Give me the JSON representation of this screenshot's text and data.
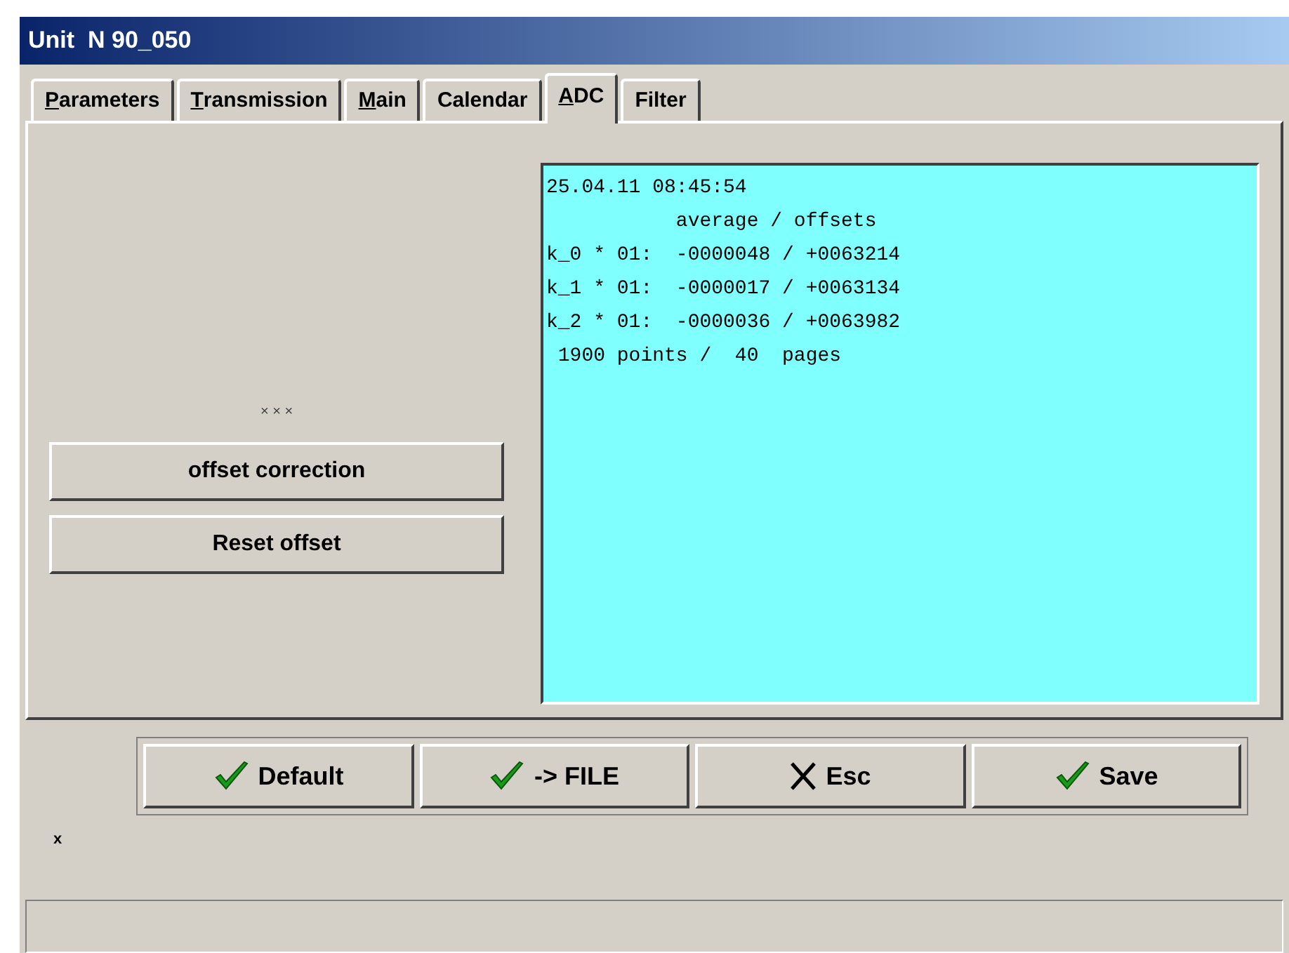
{
  "window": {
    "title": "Unit  N 90_050"
  },
  "tabs": [
    {
      "label": "Parameters",
      "mnemonic": true,
      "selected": false
    },
    {
      "label": "Transmission",
      "mnemonic": true,
      "selected": false
    },
    {
      "label": "Main",
      "mnemonic": true,
      "selected": false
    },
    {
      "label": "Calendar",
      "mnemonic": false,
      "selected": false
    },
    {
      "label": "ADC",
      "mnemonic": true,
      "selected": true
    },
    {
      "label": "Filter",
      "mnemonic": false,
      "selected": false
    }
  ],
  "left_panel": {
    "marker": "× × ×",
    "buttons": [
      "offset correction",
      "Reset offset"
    ]
  },
  "output": {
    "lines": [
      "25.04.11 08:45:54",
      "           average / offsets",
      "k_0 * 01:  -0000048 / +0063214",
      "k_1 * 01:  -0000017 / +0063134",
      "k_2 * 01:  -0000036 / +0063982",
      " 1900 points /  40  pages"
    ]
  },
  "toolbar": [
    {
      "label": "Default",
      "kind": "check"
    },
    {
      "label": "-> FILE",
      "kind": "check"
    },
    {
      "label": "Esc",
      "kind": "cross"
    },
    {
      "label": "Save",
      "kind": "check"
    }
  ],
  "footer_mark": "x"
}
